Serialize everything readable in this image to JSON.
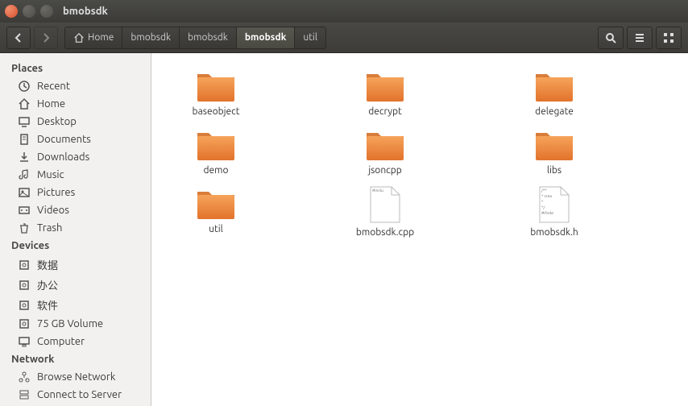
{
  "window": {
    "title": "bmobsdk"
  },
  "breadcrumbs": [
    {
      "label": "Home",
      "icon": "home"
    },
    {
      "label": "bmobsdk"
    },
    {
      "label": "bmobsdk"
    },
    {
      "label": "bmobsdk",
      "active": true
    },
    {
      "label": "util"
    }
  ],
  "sidebar": {
    "sections": [
      {
        "title": "Places",
        "items": [
          {
            "label": "Recent",
            "icon": "clock"
          },
          {
            "label": "Home",
            "icon": "home"
          },
          {
            "label": "Desktop",
            "icon": "desktop"
          },
          {
            "label": "Documents",
            "icon": "doc"
          },
          {
            "label": "Downloads",
            "icon": "download"
          },
          {
            "label": "Music",
            "icon": "music"
          },
          {
            "label": "Pictures",
            "icon": "pictures"
          },
          {
            "label": "Videos",
            "icon": "video"
          },
          {
            "label": "Trash",
            "icon": "trash"
          }
        ]
      },
      {
        "title": "Devices",
        "items": [
          {
            "label": "数据",
            "icon": "disk"
          },
          {
            "label": "办公",
            "icon": "disk"
          },
          {
            "label": "软件",
            "icon": "disk"
          },
          {
            "label": "75 GB Volume",
            "icon": "disk"
          },
          {
            "label": "Computer",
            "icon": "computer"
          }
        ]
      },
      {
        "title": "Network",
        "items": [
          {
            "label": "Browse Network",
            "icon": "network"
          },
          {
            "label": "Connect to Server",
            "icon": "server"
          }
        ]
      }
    ]
  },
  "files": [
    {
      "name": "baseobject",
      "type": "folder"
    },
    {
      "name": "decrypt",
      "type": "folder"
    },
    {
      "name": "delegate",
      "type": "folder"
    },
    {
      "name": "demo",
      "type": "folder"
    },
    {
      "name": "jsoncpp",
      "type": "folder"
    },
    {
      "name": "libs",
      "type": "folder"
    },
    {
      "name": "util",
      "type": "folder"
    },
    {
      "name": "bmobsdk.cpp",
      "type": "file",
      "preview": "#inclu"
    },
    {
      "name": "bmobsdk.h",
      "type": "file",
      "preview": "/**\\n * crea\\n *\\n */\\n#ifnde"
    }
  ]
}
